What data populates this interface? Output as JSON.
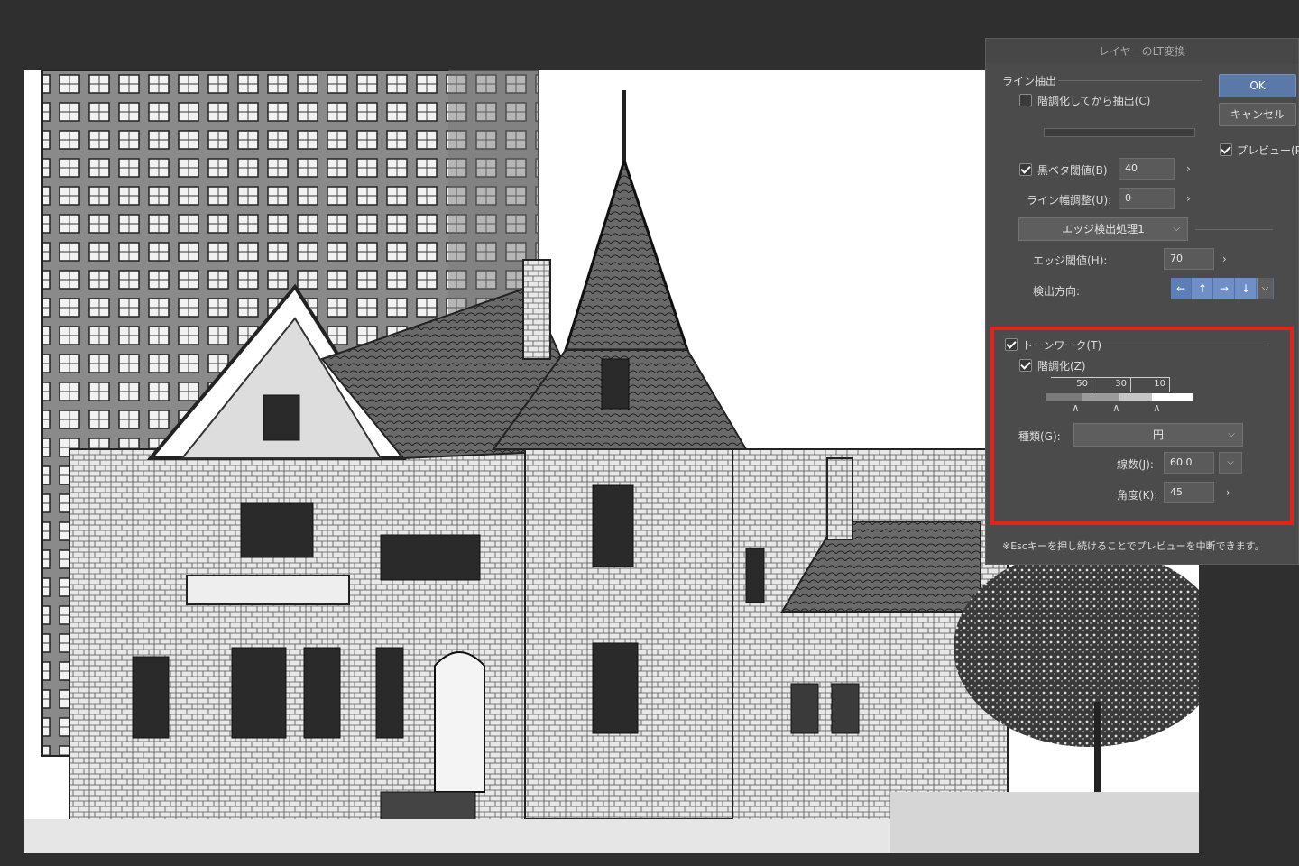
{
  "dialog": {
    "title": "レイヤーのLT変換",
    "ok_label": "OK",
    "cancel_label": "キャンセル",
    "preview_label": "プレビュー(P)",
    "preview_checked": true,
    "line_group": {
      "title": "ライン抽出",
      "tone_first_label": "階調化してから抽出(C)",
      "tone_first_checked": false,
      "black_threshold_label": "黒ベタ閾値(B)",
      "black_threshold_checked": true,
      "black_threshold_value": "40",
      "line_width_label": "ライン幅調整(U):",
      "line_width_value": "0",
      "edge_mode_value": "エッジ検出処理1",
      "edge_threshold_label": "エッジ閾値(H):",
      "edge_threshold_value": "70",
      "direction_label": "検出方向:",
      "direction_icons": [
        "arrow-left-icon",
        "arrow-up-icon",
        "arrow-right-icon",
        "arrow-down-icon"
      ]
    },
    "tone_group": {
      "title": "トーンワーク(T)",
      "tone_checked": true,
      "gradation_label": "階調化(Z)",
      "gradation_checked": true,
      "levels": [
        "50",
        "30",
        "10"
      ],
      "type_label": "種類(G):",
      "type_value": "円",
      "lines_label": "線数(J):",
      "lines_value": "60.0",
      "angle_label": "角度(K):",
      "angle_value": "45"
    },
    "note": "※Escキーを押し続けることでプレビューを中断できます。"
  },
  "colors": {
    "highlight": "#e8201c",
    "accent": "#5a78a8",
    "panel": "#4b4b4b",
    "workspace": "#2f2f2f"
  }
}
